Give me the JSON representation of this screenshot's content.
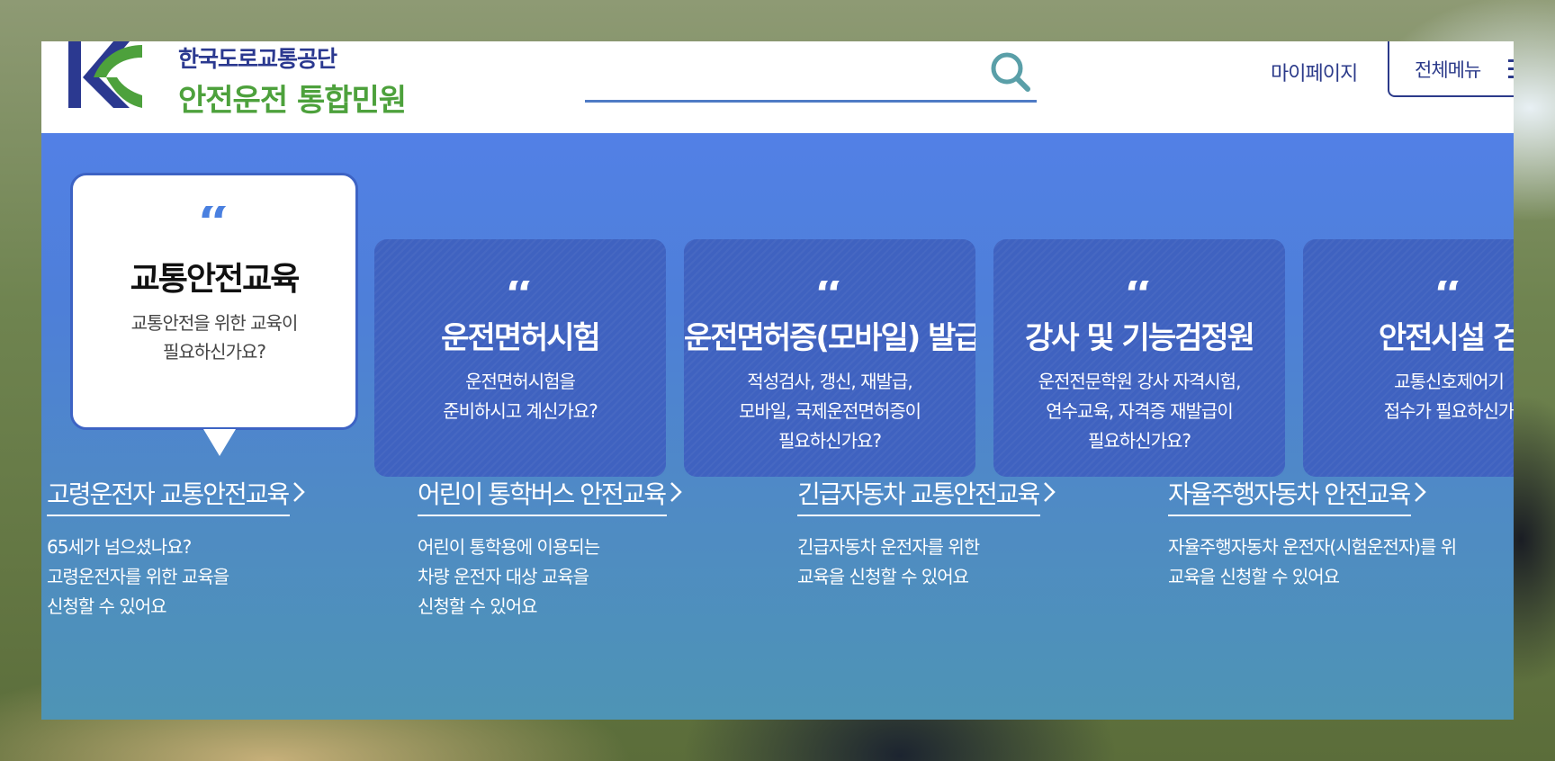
{
  "header": {
    "logo_top": "한국도로교통공단",
    "logo_bottom": "안전운전 통합민원",
    "search_placeholder": "",
    "mypage_label": "마이페이지",
    "menu_label": "전체메뉴"
  },
  "colors": {
    "brand_navy": "#2b3990",
    "brand_green": "#4da13c",
    "hero_blue": "#5280e6",
    "card_blue": "#3f62c0"
  },
  "cards": [
    {
      "quote": "“",
      "title": "교통안전교육",
      "desc": "교통안전을 위한 교육이\n필요하신가요?",
      "active": true
    },
    {
      "quote": "“",
      "title": "운전면허시험",
      "desc": "운전면허시험을\n준비하시고 계신가요?"
    },
    {
      "quote": "“",
      "title": "운전면허증(모바일) 발급",
      "desc": "적성검사, 갱신, 재발급,\n모바일, 국제운전면허증이\n필요하신가요?"
    },
    {
      "quote": "“",
      "title": "강사 및 기능검정원",
      "desc": "운전전문학원 강사 자격시험,\n연수교육, 자격증 재발급이\n필요하신가요?"
    },
    {
      "quote": "“",
      "title": "안전시설 검",
      "desc": "교통신호제어기\n접수가 필요하신가"
    }
  ],
  "links": [
    {
      "title": "고령운전자 교통안전교육",
      "desc": "65세가 넘으셨나요?\n고령운전자를 위한 교육을\n신청할 수 있어요"
    },
    {
      "title": "어린이 통학버스 안전교육",
      "desc": "어린이 통학용에 이용되는\n차량 운전자 대상 교육을\n신청할 수 있어요"
    },
    {
      "title": "긴급자동차 교통안전교육",
      "desc": "긴급자동차 운전자를 위한\n교육을 신청할 수 있어요"
    },
    {
      "title": "자율주행자동차 안전교육",
      "desc": "자율주행자동차 운전자(시험운전자)를 위\n교육을 신청할 수 있어요"
    }
  ]
}
